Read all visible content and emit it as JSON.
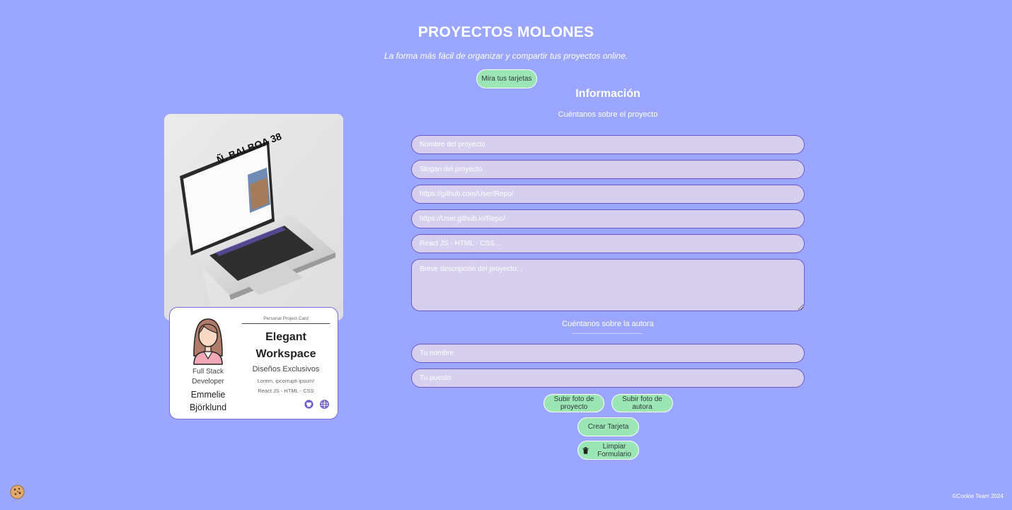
{
  "header": {
    "title": "PROYECTOS MOLONES",
    "subtitle": "La forma más fácil de organizar y compartir tus proyectos online.",
    "cards_button": "Mira tus tarjetas"
  },
  "preview": {
    "screen_brand": "Ñ. BALBOA 38",
    "card": {
      "label": "Personal Project Card",
      "job": "Full Stack Developer",
      "author": "Emmelie Björklund",
      "name": "Elegant Workspace",
      "slogan": "Diseños Exclusivos",
      "desc": "Lorem, ipcorrupti ipsum!",
      "tech": "React JS - HTML - CSS"
    }
  },
  "form": {
    "heading": "Información",
    "project_section": "Cuéntanos sobre el proyecto",
    "author_section": "Cuéntanos sobre la autora",
    "placeholders": {
      "name": "Nombre del proyecto",
      "slogan": "Slogan del proyecto",
      "repo": "https://github.com/User/Repo/",
      "demo": "https://User.github.io/Repo/",
      "tech": "React JS - HTML - CSS...",
      "desc": "Breve descripción del proyecto...",
      "author": "Tu nombre",
      "job": "Tu puesto"
    },
    "buttons": {
      "upload_project": "Subir foto de proyecto",
      "upload_author": "Subir foto de autora",
      "create": "Crear Tarjeta",
      "reset": "Limpiar Formulario"
    }
  },
  "footer": {
    "copyright": "©Cookie Team 2024"
  },
  "colors": {
    "background": "#9ba7fe",
    "button": "#9ce6b5",
    "field": "#d7cfee",
    "field_border": "#6a5acd"
  }
}
